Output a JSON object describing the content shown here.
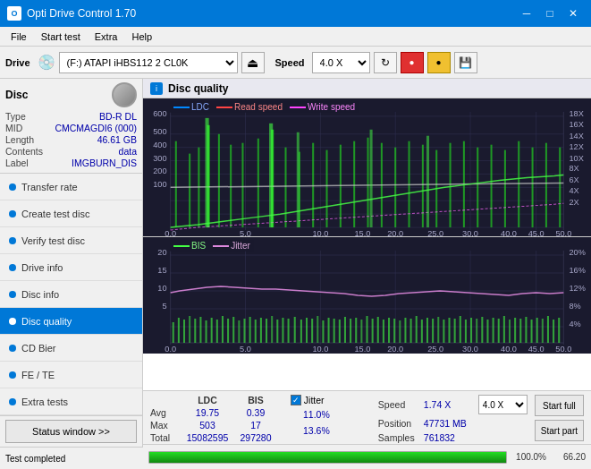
{
  "titlebar": {
    "title": "Opti Drive Control 1.70",
    "minimize": "─",
    "maximize": "□",
    "close": "✕"
  },
  "menubar": {
    "items": [
      "File",
      "Start test",
      "Extra",
      "Help"
    ]
  },
  "toolbar": {
    "drive_label": "Drive",
    "drive_value": "(F:)  ATAPI iHBS112  2 CL0K",
    "speed_label": "Speed",
    "speed_value": "4.0 X"
  },
  "disc": {
    "title": "Disc",
    "type_label": "Type",
    "type_value": "BD-R DL",
    "mid_label": "MID",
    "mid_value": "CMCMAGDI6 (000)",
    "length_label": "Length",
    "length_value": "46.61 GB",
    "contents_label": "Contents",
    "contents_value": "data",
    "label_label": "Label",
    "label_value": "IMGBURN_DIS"
  },
  "nav": {
    "items": [
      {
        "id": "transfer-rate",
        "label": "Transfer rate",
        "active": false
      },
      {
        "id": "create-test-disc",
        "label": "Create test disc",
        "active": false
      },
      {
        "id": "verify-test-disc",
        "label": "Verify test disc",
        "active": false
      },
      {
        "id": "drive-info",
        "label": "Drive info",
        "active": false
      },
      {
        "id": "disc-info",
        "label": "Disc info",
        "active": false
      },
      {
        "id": "disc-quality",
        "label": "Disc quality",
        "active": true
      },
      {
        "id": "cd-bier",
        "label": "CD Bier",
        "active": false
      },
      {
        "id": "fe-te",
        "label": "FE / TE",
        "active": false
      },
      {
        "id": "extra-tests",
        "label": "Extra tests",
        "active": false
      }
    ]
  },
  "status_btn": "Status window >>",
  "progress": {
    "label": "Test completed",
    "pct": "100.0%",
    "speed": "66.20"
  },
  "disc_quality": {
    "title": "Disc quality",
    "icon": "i",
    "legend1": {
      "ldc_label": "LDC",
      "read_label": "Read speed",
      "write_label": "Write speed"
    },
    "legend2": {
      "bis_label": "BIS",
      "jitter_label": "Jitter"
    }
  },
  "stats": {
    "headers": [
      "LDC",
      "BIS"
    ],
    "rows": [
      {
        "label": "Avg",
        "ldc": "19.75",
        "bis": "0.39",
        "jitter_val": "11.0%"
      },
      {
        "label": "Max",
        "ldc": "503",
        "bis": "17",
        "jitter_val": "13.6%"
      },
      {
        "label": "Total",
        "ldc": "15082595",
        "bis": "297280",
        "jitter_val": ""
      }
    ],
    "jitter_label": "Jitter",
    "speed_label": "Speed",
    "speed_val": "1.74 X",
    "speed_max": "4.0 X",
    "position_label": "Position",
    "position_val": "47731 MB",
    "samples_label": "Samples",
    "samples_val": "761832",
    "start_full_btn": "Start full",
    "start_part_btn": "Start part"
  }
}
